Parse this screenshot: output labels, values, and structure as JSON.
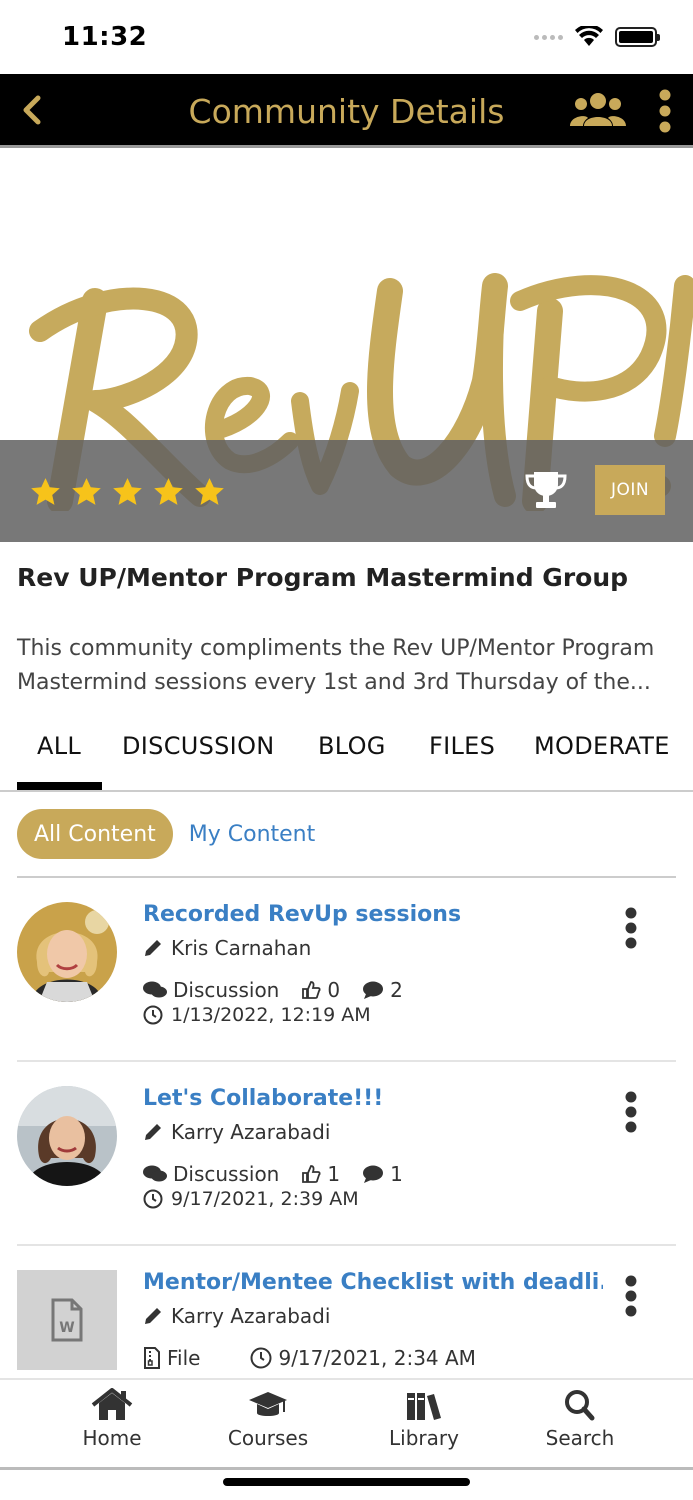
{
  "status_bar": {
    "time": "11:32"
  },
  "nav": {
    "title": "Community Details"
  },
  "banner": {
    "logo_text": "Rev UP!",
    "rating": 5,
    "join_label": "JOIN"
  },
  "community": {
    "title": "Rev UP/Mentor Program Mastermind Group",
    "description": "This community compliments the Rev UP/Mentor Program Mastermind sessions every 1st and 3rd Thursday of the..."
  },
  "tabs": [
    {
      "label": "ALL",
      "active": true
    },
    {
      "label": "DISCUSSION"
    },
    {
      "label": "BLOG"
    },
    {
      "label": "FILES"
    },
    {
      "label": "MODERATE"
    }
  ],
  "filters": {
    "active": "All Content",
    "other": "My Content"
  },
  "items": [
    {
      "title": "Recorded RevUp sessions",
      "author": "Kris Carnahan",
      "type": "Discussion",
      "likes": "0",
      "comments": "2",
      "date": "1/13/2022, 12:19 AM"
    },
    {
      "title": "Let's Collaborate!!!",
      "author": "Karry Azarabadi",
      "type": "Discussion",
      "likes": "1",
      "comments": "1",
      "date": "9/17/2021, 2:39 AM"
    },
    {
      "title": "Mentor/Mentee Checklist with deadli...",
      "author": "Karry Azarabadi",
      "type": "File",
      "date": "9/17/2021, 2:34 AM"
    }
  ],
  "bottom_nav": [
    {
      "label": "Home",
      "icon": "home-icon"
    },
    {
      "label": "Courses",
      "icon": "graduation-cap-icon"
    },
    {
      "label": "Library",
      "icon": "books-icon"
    },
    {
      "label": "Search",
      "icon": "search-icon"
    }
  ],
  "colors": {
    "gold": "#c8a95a",
    "link_blue": "#3a7fc4",
    "nav_bg": "#000000"
  }
}
